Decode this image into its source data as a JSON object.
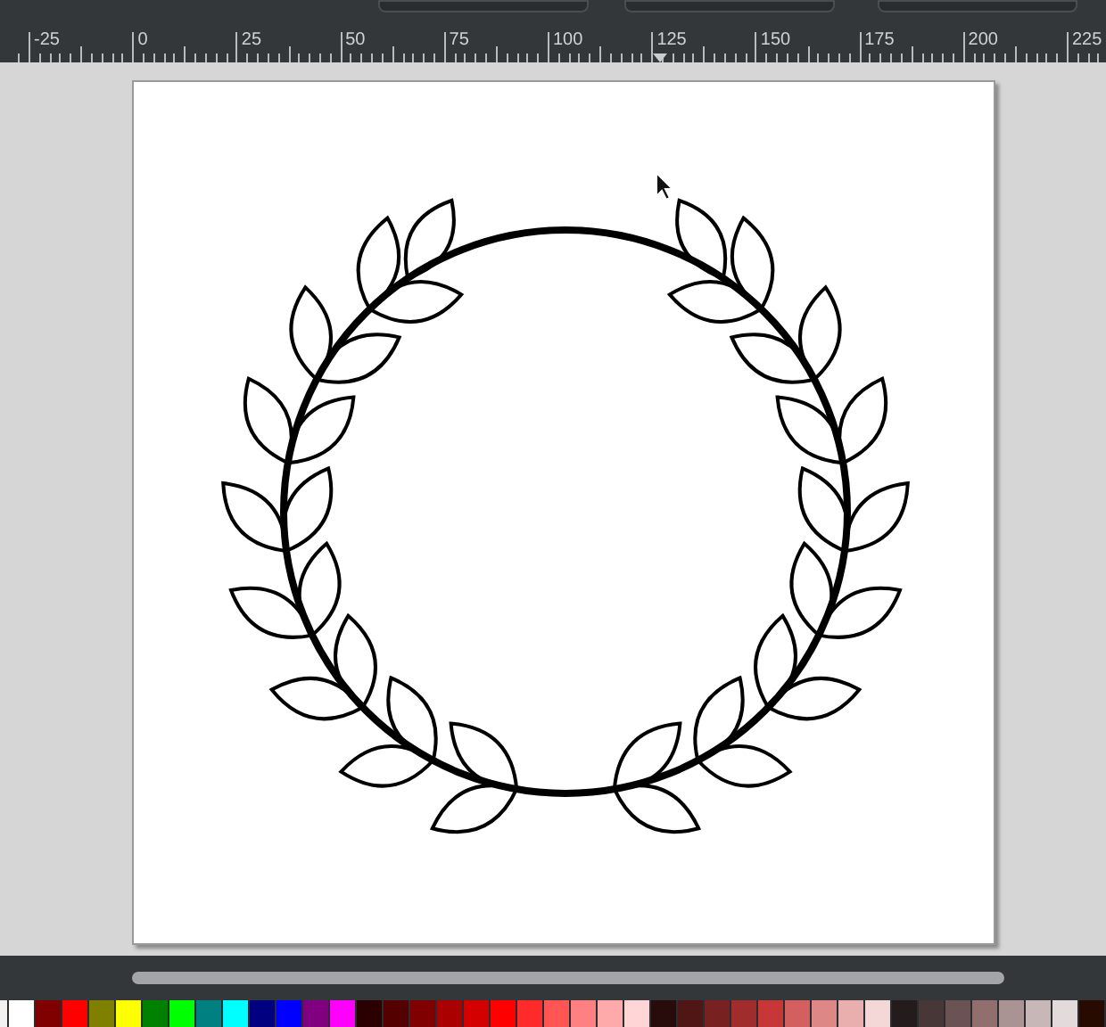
{
  "ruler": {
    "labels": [
      "-25",
      "0",
      "25",
      "50",
      "75",
      "100",
      "125",
      "150",
      "175",
      "200",
      "225"
    ]
  },
  "palette": [
    {
      "color": "#f2f2f2"
    },
    {
      "color": "#ffffff"
    },
    {
      "color": "#800000"
    },
    {
      "color": "#ff0000"
    },
    {
      "color": "#808000"
    },
    {
      "color": "#ffff00"
    },
    {
      "color": "#008000"
    },
    {
      "color": "#00ff00"
    },
    {
      "color": "#008080"
    },
    {
      "color": "#00ffff"
    },
    {
      "color": "#000080"
    },
    {
      "color": "#0000ff"
    },
    {
      "color": "#800080"
    },
    {
      "color": "#ff00ff"
    },
    {
      "color": "#2b0000"
    },
    {
      "color": "#550000"
    },
    {
      "color": "#800000"
    },
    {
      "color": "#aa0000"
    },
    {
      "color": "#d40000"
    },
    {
      "color": "#ff0000"
    },
    {
      "color": "#ff2a2a"
    },
    {
      "color": "#ff5555"
    },
    {
      "color": "#ff8080"
    },
    {
      "color": "#ffaaaa"
    },
    {
      "color": "#ffd5d5"
    },
    {
      "color": "#280b0b"
    },
    {
      "color": "#501616"
    },
    {
      "color": "#782121"
    },
    {
      "color": "#a02c2c"
    },
    {
      "color": "#c83737"
    },
    {
      "color": "#d35f5f"
    },
    {
      "color": "#de8787"
    },
    {
      "color": "#e9afaf"
    },
    {
      "color": "#f4d7d7"
    },
    {
      "color": "#241c1c"
    },
    {
      "color": "#483737"
    },
    {
      "color": "#6c5353"
    },
    {
      "color": "#916f6f"
    },
    {
      "color": "#ac9393"
    },
    {
      "color": "#c8b7b7"
    },
    {
      "color": "#e3dbdb"
    },
    {
      "color": "#280b00"
    }
  ]
}
